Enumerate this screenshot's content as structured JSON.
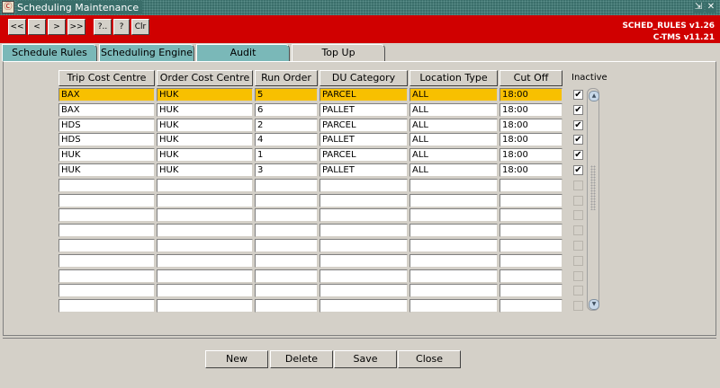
{
  "window": {
    "title": "Scheduling Maintenance",
    "minimize_glyph": "⇲",
    "close_glyph": "✕",
    "app_icon_glyph": "Ⓒ"
  },
  "toolbar": {
    "buttons": [
      {
        "label": "<<",
        "icon": "first-record-icon"
      },
      {
        "label": "<",
        "icon": "previous-record-icon"
      },
      {
        "label": ">",
        "icon": "next-record-icon"
      },
      {
        "label": ">>",
        "icon": "last-record-icon"
      },
      {
        "label": "?..",
        "icon": "query-icon"
      },
      {
        "label": "?",
        "icon": "help-icon"
      },
      {
        "label": "Clr",
        "icon": "clear-icon"
      }
    ],
    "version_line1": "SCHED_RULES v1.26",
    "version_line2": "C-TMS v11.21"
  },
  "tabs": [
    {
      "label": "Schedule Rules",
      "active": false
    },
    {
      "label": "Scheduling Engine",
      "active": false
    },
    {
      "label": "Audit",
      "active": false
    },
    {
      "label": "Top Up",
      "active": true
    }
  ],
  "grid": {
    "columns": [
      "Trip Cost Centre",
      "Order Cost Centre",
      "Run Order",
      "DU Category",
      "Location Type",
      "Cut Off",
      "Inactive"
    ],
    "rows": [
      {
        "trip": "BAX",
        "order": "HUK",
        "run": "5",
        "du": "PARCEL",
        "loc": "ALL",
        "cutoff": "18:00",
        "inactive": "✔",
        "selected": true
      },
      {
        "trip": "BAX",
        "order": "HUK",
        "run": "6",
        "du": "PALLET",
        "loc": "ALL",
        "cutoff": "18:00",
        "inactive": "✔"
      },
      {
        "trip": "HDS",
        "order": "HUK",
        "run": "2",
        "du": "PARCEL",
        "loc": "ALL",
        "cutoff": "18:00",
        "inactive": "✔"
      },
      {
        "trip": "HDS",
        "order": "HUK",
        "run": "4",
        "du": "PALLET",
        "loc": "ALL",
        "cutoff": "18:00",
        "inactive": "✔"
      },
      {
        "trip": "HUK",
        "order": "HUK",
        "run": "1",
        "du": "PARCEL",
        "loc": "ALL",
        "cutoff": "18:00",
        "inactive": "✔"
      },
      {
        "trip": "HUK",
        "order": "HUK",
        "run": "3",
        "du": "PALLET",
        "loc": "ALL",
        "cutoff": "18:00",
        "inactive": "✔"
      }
    ],
    "empty_rows": 9,
    "scroll_up_glyph": "▲",
    "scroll_down_glyph": "▼"
  },
  "actions": {
    "new": "New",
    "delete": "Delete",
    "save": "Save",
    "close": "Close"
  },
  "colors": {
    "header_red": "#d00000",
    "tab_teal": "#7ab8b8",
    "selected_row": "#f8c000",
    "title_green": "#3a6e6a"
  }
}
